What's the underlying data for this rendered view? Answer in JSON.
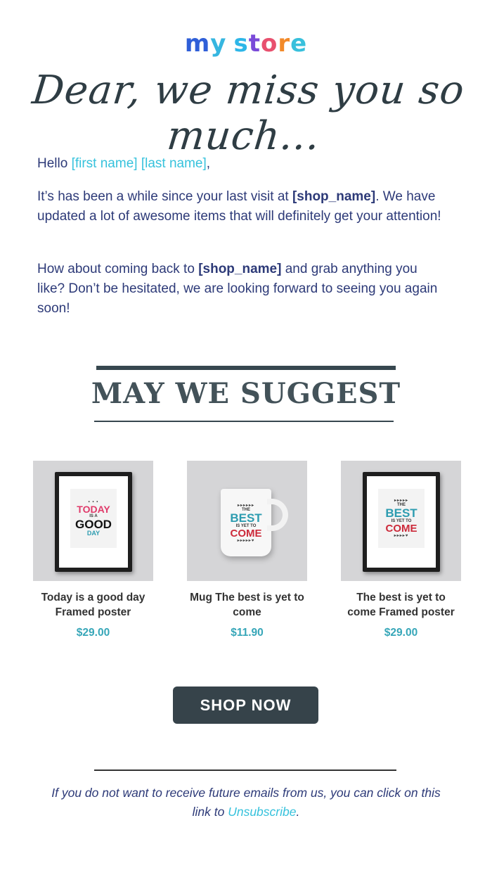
{
  "brand": {
    "logo_parts": [
      "m",
      "y",
      " ",
      "s",
      "t",
      "o",
      "r",
      "e"
    ],
    "logo_colors": [
      "#2f5fd8",
      "#36b6e0",
      "#ffffff",
      "#2db6e8",
      "#7a4ad8",
      "#e8506e",
      "#f28a2a",
      "#38c0dc"
    ]
  },
  "headline": "Dear, we miss you so much...",
  "greeting": {
    "prefix": "Hello ",
    "name_token": "[first name] [last name]",
    "suffix": ","
  },
  "paragraph1": {
    "part1": "It’s has been a while since your last visit at ",
    "shop_token": "[shop_name]",
    "part2": ". We have updated a lot of awesome items that will definitely get your attention!"
  },
  "paragraph2": {
    "part1": "How about coming back to ",
    "shop_token": "[shop_name]",
    "part2": " and grab anything you like? Don’t be hesitated, we are looking forward to seeing you again soon!"
  },
  "suggest_heading": "MAY WE SUGGEST",
  "products": [
    {
      "name": "Today is a good day Framed poster",
      "price": "$29.00",
      "art": {
        "line1": "TODAY",
        "line2": "IS A",
        "line3": "GOOD",
        "line4": "DAY"
      }
    },
    {
      "name": "Mug The best is yet to come",
      "price": "$11.90",
      "art": {
        "line1": "THE",
        "line2": "BEST",
        "line3": "IS YET TO",
        "line4": "COME"
      }
    },
    {
      "name": "The best is yet to come Framed poster",
      "price": "$29.00",
      "art": {
        "line1": "THE",
        "line2": "BEST",
        "line3": "IS YET TO",
        "line4": "COME"
      }
    }
  ],
  "cta_label": "SHOP NOW",
  "footer": {
    "text": "If you do not want to receive future emails from us, you can click on this link to ",
    "link": "Unsubscribe",
    "end": "."
  },
  "colors": {
    "accent": "#36c2dc",
    "text": "#2d3a78",
    "button": "#36434a",
    "price": "#36a6b8"
  }
}
